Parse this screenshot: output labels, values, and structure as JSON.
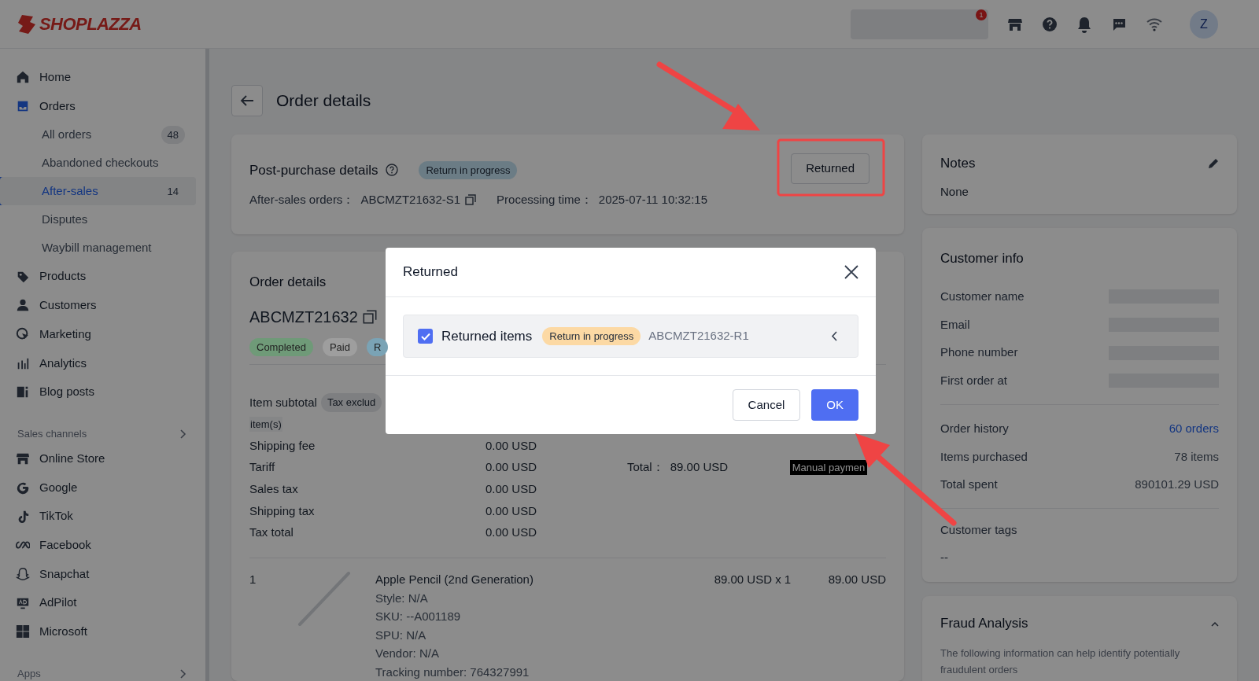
{
  "header": {
    "logo": "SHOPLAZZA",
    "notification_count": "1",
    "avatar": "Z"
  },
  "sidebar": {
    "items": [
      {
        "label": "Home",
        "selected": false
      },
      {
        "label": "Orders",
        "selected": false,
        "children": [
          {
            "label": "All orders",
            "count": "48",
            "selected": false
          },
          {
            "label": "Abandoned checkouts",
            "selected": false
          },
          {
            "label": "After-sales",
            "count": "14",
            "selected": true
          },
          {
            "label": "Disputes",
            "selected": false
          },
          {
            "label": "Waybill management",
            "selected": false
          }
        ]
      },
      {
        "label": "Products",
        "selected": false
      },
      {
        "label": "Customers",
        "selected": false
      },
      {
        "label": "Marketing",
        "selected": false
      },
      {
        "label": "Analytics",
        "selected": false
      },
      {
        "label": "Blog posts",
        "selected": false
      }
    ],
    "sections": [
      {
        "title": "Sales channels",
        "items": [
          {
            "label": "Online Store",
            "selected": false
          },
          {
            "label": "Google",
            "selected": false
          },
          {
            "label": "TikTok",
            "selected": false
          },
          {
            "label": "Facebook",
            "selected": false
          },
          {
            "label": "Snapchat",
            "selected": false
          },
          {
            "label": "AdPilot",
            "selected": false
          },
          {
            "label": "Microsoft",
            "selected": false
          }
        ]
      },
      {
        "title": "Apps"
      }
    ]
  },
  "page_title": "Order details",
  "post_purchase": {
    "title": "Post-purchase details",
    "status": "Return in progress",
    "after_sales_label": "After-sales orders：",
    "after_sales_value": "ABCMZT21632-S1",
    "processing_label": "Processing time：",
    "processing_value": "2025-07-11 10:32:15",
    "button": "Returned"
  },
  "order": {
    "title": "Order details",
    "number": "ABCMZT21632",
    "badges": [
      {
        "label": "Completed",
        "color": "#6f9a78"
      },
      {
        "label": "Paid",
        "color": "#9e9e9e"
      },
      {
        "label": "R",
        "color": "#7aa3b5"
      }
    ],
    "subtotal_label": "Item subtotal",
    "subtotal_tag": "Tax exclud",
    "subtotal_note": "item(s)",
    "rows": [
      {
        "label": "Shipping fee",
        "value": "0.00 USD"
      },
      {
        "label": "Tariff",
        "value": "0.00 USD"
      },
      {
        "label": "Sales tax",
        "value": "0.00 USD"
      },
      {
        "label": "Shipping tax",
        "value": "0.00 USD"
      },
      {
        "label": "Tax total",
        "value": "0.00 USD"
      }
    ],
    "total_label": "Total：",
    "total_value": "89.00 USD",
    "payment_tag": "Manual paymen",
    "line_item": {
      "index": "1",
      "name": "Apple Pencil (2nd Generation)",
      "details": [
        "Style: N/A",
        "SKU: --A001189",
        "SPU: N/A",
        "Vendor: N/A",
        "Tracking number: 764327991"
      ],
      "unit_price": "89.00 USD x 1",
      "total": "89.00 USD"
    }
  },
  "notes": {
    "title": "Notes",
    "value": "None"
  },
  "customer_info": {
    "title": "Customer info",
    "fields": [
      "Customer name",
      "Email",
      "Phone number",
      "First order at"
    ],
    "stats": [
      {
        "label": "Order history",
        "value": "60 orders",
        "kind": "link"
      },
      {
        "label": "Items purchased",
        "value": "78 items",
        "kind": "text"
      },
      {
        "label": "Total spent",
        "value": "890101.29 USD",
        "kind": "text"
      }
    ],
    "tags_title": "Customer tags",
    "tags_value": "--"
  },
  "fraud": {
    "title": "Fraud Analysis",
    "expanded": true,
    "description": "The following information can help identify potentially fraudulent orders"
  },
  "modal": {
    "title": "Returned",
    "item": {
      "checked": true,
      "label": "Returned items",
      "status": "Return in progress",
      "code": "ABCMZT21632-R1"
    },
    "buttons": [
      {
        "label": "Cancel",
        "kind": "secondary"
      },
      {
        "label": "OK",
        "kind": "primary"
      }
    ]
  }
}
